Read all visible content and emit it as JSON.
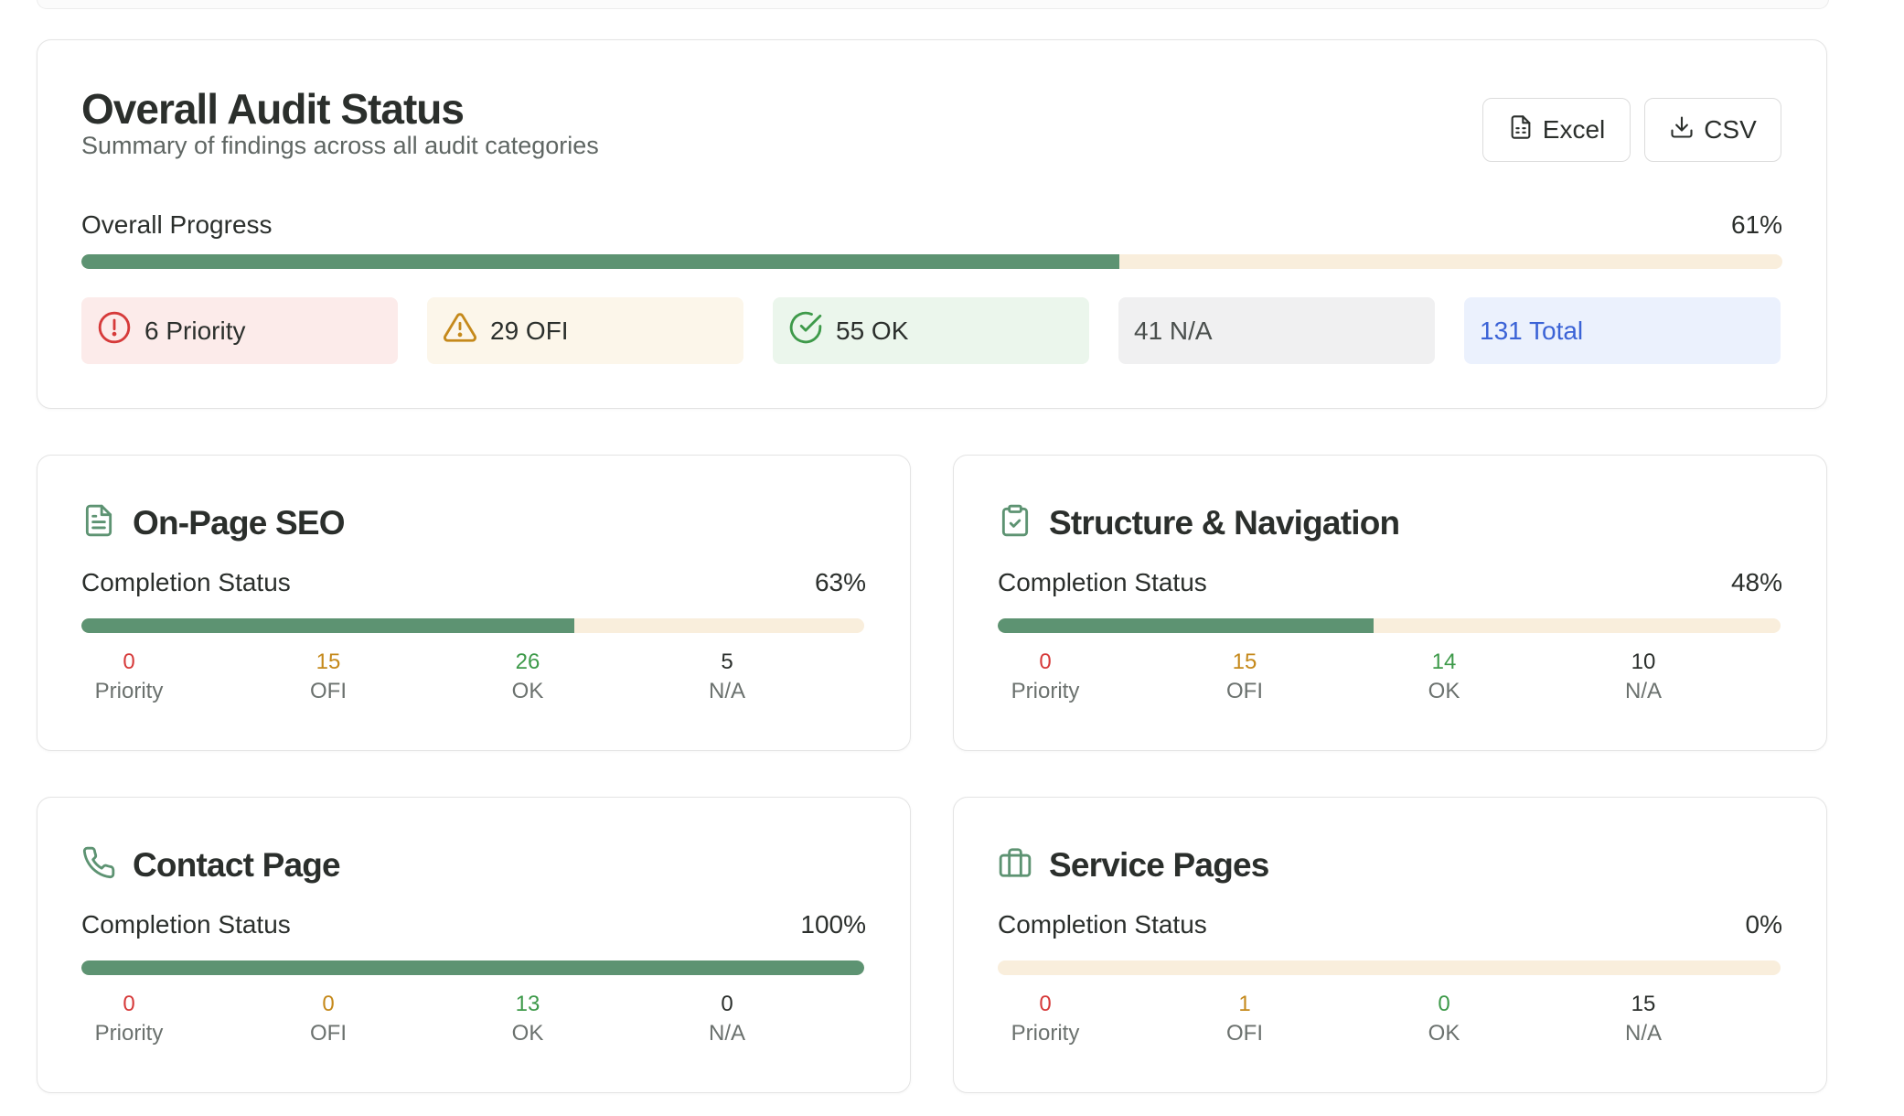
{
  "overall": {
    "title": "Overall Audit Status",
    "subtitle": "Summary of findings across all audit categories",
    "buttons": {
      "excel": "Excel",
      "csv": "CSV"
    },
    "progress_label": "Overall Progress",
    "progress_pct": "61%",
    "progress_value": 0.61,
    "chips": {
      "priority": "6 Priority",
      "ofi": "29 OFI",
      "ok": "55 OK",
      "na": "41 N/A",
      "total": "131 Total"
    }
  },
  "labels": {
    "completion": "Completion Status",
    "priority": "Priority",
    "ofi": "OFI",
    "ok": "OK",
    "na": "N/A"
  },
  "categories": [
    {
      "title": "On-Page SEO",
      "icon": "document-icon",
      "pct": "63%",
      "value": 0.63,
      "priority": "0",
      "ofi": "15",
      "ok": "26",
      "na": "5"
    },
    {
      "title": "Structure & Navigation",
      "icon": "clipboard-check-icon",
      "pct": "48%",
      "value": 0.48,
      "priority": "0",
      "ofi": "15",
      "ok": "14",
      "na": "10"
    },
    {
      "title": "Contact Page",
      "icon": "phone-icon",
      "pct": "100%",
      "value": 1.0,
      "priority": "0",
      "ofi": "0",
      "ok": "13",
      "na": "0"
    },
    {
      "title": "Service Pages",
      "icon": "briefcase-icon",
      "pct": "0%",
      "value": 0.0,
      "priority": "0",
      "ofi": "1",
      "ok": "0",
      "na": "15"
    }
  ],
  "colors": {
    "progress_fill": "#5d9372",
    "progress_track": "#f9eedc",
    "priority": "#d63a3a",
    "ofi": "#c5891b",
    "ok": "#3e9a4a",
    "total": "#3b63d6"
  }
}
